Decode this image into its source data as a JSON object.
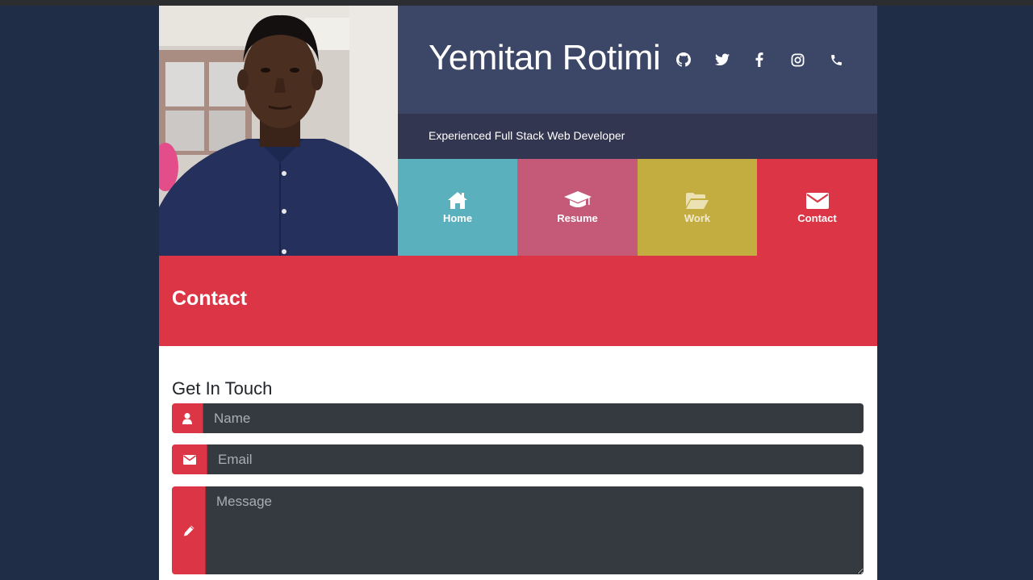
{
  "profile": {
    "name": "Yemitan Rotimi",
    "tagline": "Experienced Full Stack Web Developer"
  },
  "socials": [
    {
      "icon": "github-icon"
    },
    {
      "icon": "twitter-icon"
    },
    {
      "icon": "facebook-icon"
    },
    {
      "icon": "instagram-icon"
    },
    {
      "icon": "phone-icon"
    }
  ],
  "nav": {
    "items": [
      {
        "label": "Home",
        "icon": "home-icon",
        "color": "#5ab0bd"
      },
      {
        "label": "Resume",
        "icon": "graduation-cap-icon",
        "color": "#c55a78"
      },
      {
        "label": "Work",
        "icon": "folder-open-icon",
        "color": "#c4ad40"
      },
      {
        "label": "Contact",
        "icon": "envelope-icon",
        "color": "#dc3545"
      }
    ]
  },
  "banner": {
    "title": "Contact"
  },
  "form": {
    "heading": "Get In Touch",
    "name_placeholder": "Name",
    "email_placeholder": "Email",
    "message_placeholder": "Message"
  },
  "colors": {
    "background": "#1f2d47",
    "name_bar": "#3c4767",
    "tagline_bar": "#333650",
    "accent": "#dc3545",
    "input_bg": "#343a40"
  }
}
